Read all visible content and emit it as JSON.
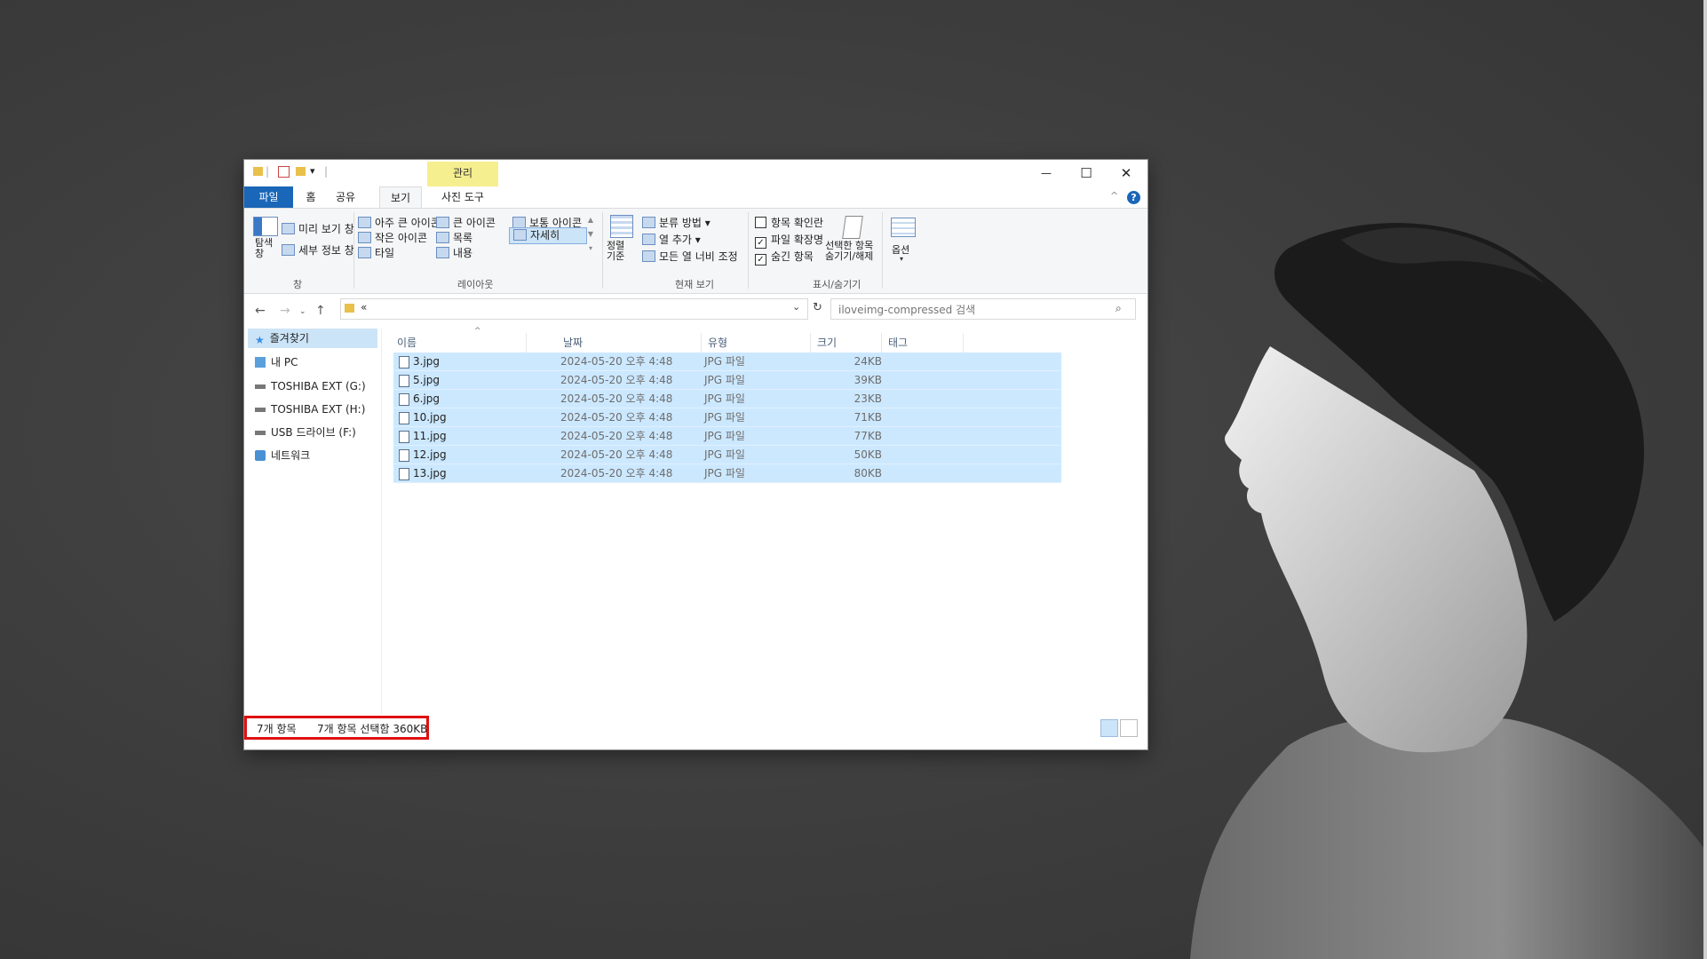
{
  "quick_access_toolbar": {
    "customize_arrow": "▾"
  },
  "contextual_tab": {
    "label": "관리"
  },
  "window_controls": {
    "minimize": "—",
    "maximize": "☐",
    "close": "✕"
  },
  "tabs": {
    "file": "파일",
    "home": "홈",
    "share": "공유",
    "view": "보기",
    "picture_tools": "사진 도구"
  },
  "ribbon": {
    "panes": {
      "nav_pane": "탐색\n창",
      "preview_pane": "미리 보기 창",
      "details_pane": "세부 정보 창",
      "group_label": "창"
    },
    "layout": {
      "extra_large_icons": "아주 큰 아이콘",
      "large_icons": "큰 아이콘",
      "medium_icons": "보통 아이콘",
      "small_icons": "작은 아이콘",
      "list": "목록",
      "details": "자세히",
      "tiles": "타일",
      "content": "내용",
      "group_label": "레이아웃"
    },
    "current_view": {
      "sort_by": "정렬\n기준",
      "group_by": "분류 방법",
      "add_columns": "열 추가",
      "size_all_columns": "모든 열 너비 조정",
      "group_label": "현재 보기"
    },
    "show_hide": {
      "item_check_boxes": "항목 확인란",
      "file_name_extensions": "파일 확장명",
      "hidden_items": "숨긴 항목",
      "hide_selected": "선택한 항목\n숨기기/해제",
      "group_label": "표시/숨기기",
      "item_check_boxes_checked": false,
      "file_name_extensions_checked": true,
      "hidden_items_checked": true
    },
    "options": "옵션"
  },
  "address": {
    "path": "«",
    "search_placeholder": "iloveimg-compressed 검색"
  },
  "nav_pane": [
    {
      "label": "즐겨찾기",
      "selected": true
    },
    {
      "label": "내 PC"
    },
    {
      "label": "TOSHIBA EXT (G:)"
    },
    {
      "label": "TOSHIBA EXT (H:)"
    },
    {
      "label": "USB 드라이브 (F:)"
    },
    {
      "label": "네트워크"
    }
  ],
  "columns": {
    "name": "이름",
    "date": "날짜",
    "type": "유형",
    "size": "크기",
    "tags": "태그"
  },
  "files": [
    {
      "name": "3.jpg",
      "date": "2024-05-20 오후 4:48",
      "type": "JPG 파일",
      "size": "24KB"
    },
    {
      "name": "5.jpg",
      "date": "2024-05-20 오후 4:48",
      "type": "JPG 파일",
      "size": "39KB"
    },
    {
      "name": "6.jpg",
      "date": "2024-05-20 오후 4:48",
      "type": "JPG 파일",
      "size": "23KB"
    },
    {
      "name": "10.jpg",
      "date": "2024-05-20 오후 4:48",
      "type": "JPG 파일",
      "size": "71KB"
    },
    {
      "name": "11.jpg",
      "date": "2024-05-20 오후 4:48",
      "type": "JPG 파일",
      "size": "77KB"
    },
    {
      "name": "12.jpg",
      "date": "2024-05-20 오후 4:48",
      "type": "JPG 파일",
      "size": "50KB"
    },
    {
      "name": "13.jpg",
      "date": "2024-05-20 오후 4:48",
      "type": "JPG 파일",
      "size": "80KB"
    }
  ],
  "status": {
    "item_count": "7개 항목",
    "selection": "7개 항목 선택함 360KB"
  },
  "colors": {
    "file_tab": "#1a66b8",
    "selection": "#cce8ff",
    "contextual_tab": "#f6ef8f",
    "highlight_box": "#e01010"
  }
}
